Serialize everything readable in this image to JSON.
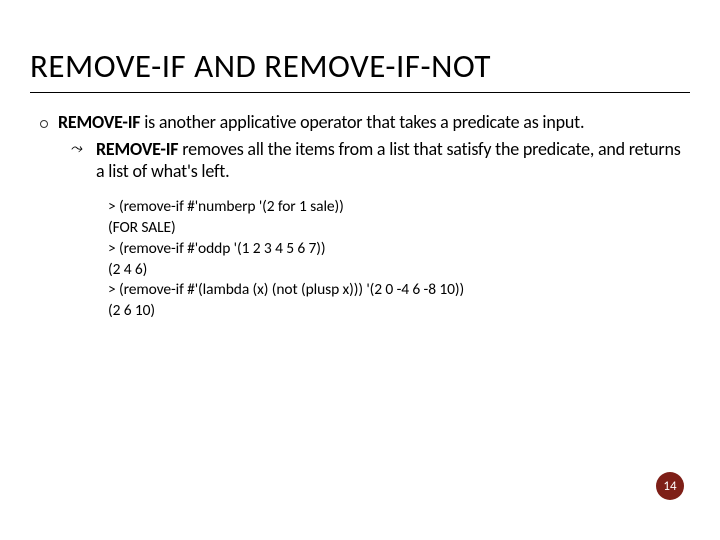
{
  "title": "REMOVE-IF AND REMOVE-IF-NOT",
  "bullet1_strong": "REMOVE-IF",
  "bullet1_rest": " is another applicative operator that takes a predicate as input.",
  "bullet2_strong": "REMOVE-IF",
  "bullet2_rest": " removes all the items from a list that satisfy the predicate, and returns a list of what's left.",
  "code": [
    "> (remove-if #'numberp '(2 for 1 sale))",
    "(FOR SALE)",
    "> (remove-if #'oddp '(1 2 3 4 5 6 7))",
    "(2 4 6)",
    "> (remove-if #'(lambda (x) (not (plusp x))) '(2 0 -4 6 -8 10))",
    "(2 6 10)"
  ],
  "page_number": "14"
}
